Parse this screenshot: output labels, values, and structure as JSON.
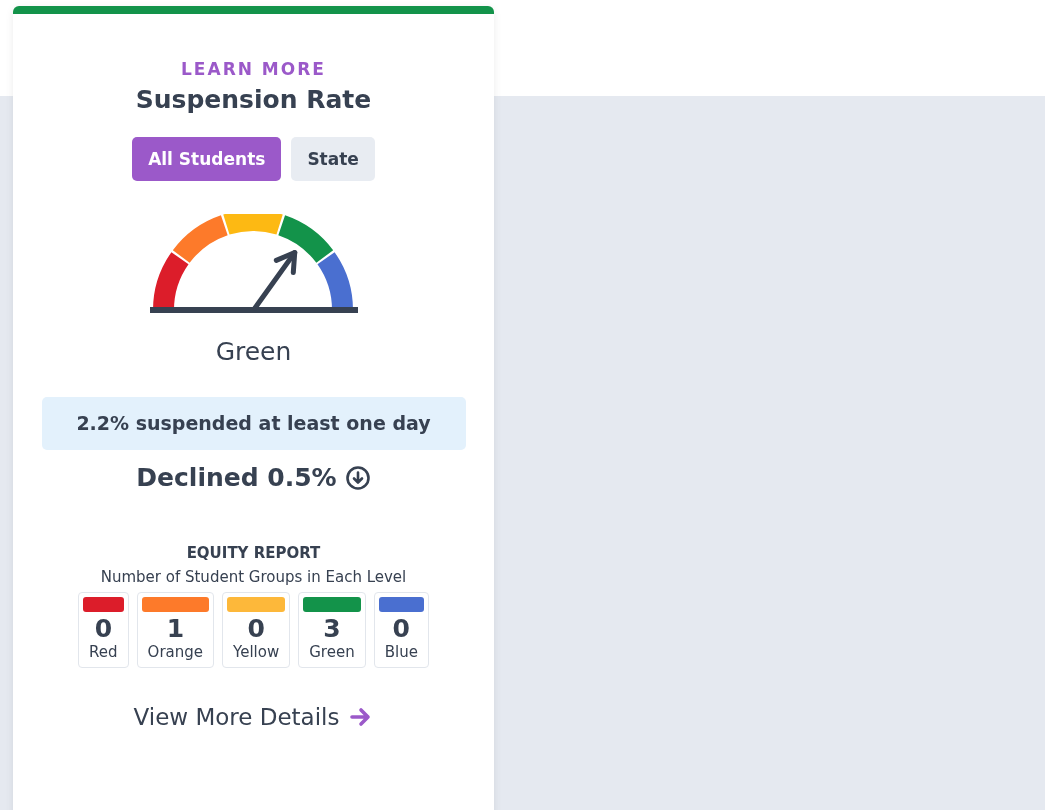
{
  "card": {
    "link": "LEARN MORE",
    "title": "Suspension Rate",
    "toggles": [
      {
        "label": "All Students",
        "selected": true
      },
      {
        "label": "State",
        "selected": false
      }
    ],
    "gauge": {
      "segments": [
        {
          "color": "#dc1d2a"
        },
        {
          "color": "#fd7a2a"
        },
        {
          "color": "#fdb913"
        },
        {
          "color": "#13934a"
        },
        {
          "color": "#4a6fd0"
        }
      ],
      "label": "Green"
    },
    "rate": "2.2% suspended at least one day",
    "change": "Declined 0.5%",
    "equity": {
      "title": "EQUITY REPORT",
      "subtitle": "Number of Student Groups in Each Level",
      "levels": [
        {
          "count": "0",
          "label": "Red",
          "color": "#dc1d2a"
        },
        {
          "count": "1",
          "label": "Orange",
          "color": "#fd7a2a"
        },
        {
          "count": "0",
          "label": "Yellow",
          "color": "#fdb83a"
        },
        {
          "count": "3",
          "label": "Green",
          "color": "#13934a"
        },
        {
          "count": "0",
          "label": "Blue",
          "color": "#4a6fd0"
        }
      ]
    },
    "details_link": "View More Details"
  }
}
